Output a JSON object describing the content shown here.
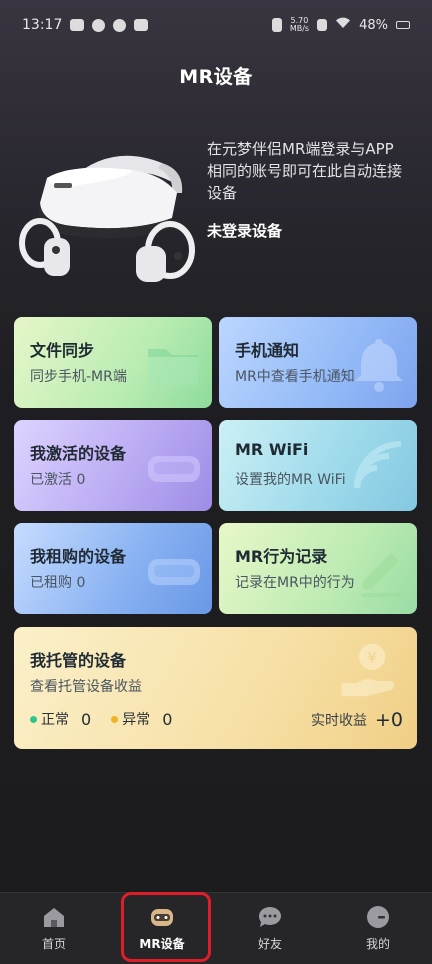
{
  "status_bar": {
    "time": "13:17",
    "net_speed_value": "5.70",
    "net_speed_unit": "MB/s",
    "battery": "48%"
  },
  "header": {
    "title": "MR设备"
  },
  "hero": {
    "description": "在元梦伴侣MR端登录与APP相同的账号即可在此自动连接设备",
    "status": "未登录设备"
  },
  "cards": {
    "file_sync": {
      "title": "文件同步",
      "subtitle": "同步手机-MR端"
    },
    "phone_notice": {
      "title": "手机通知",
      "subtitle": "MR中查看手机通知"
    },
    "activated": {
      "title": "我激活的设备",
      "subtitle": "已激活 0"
    },
    "wifi": {
      "title": "MR WiFi",
      "subtitle": "设置我的MR WiFi"
    },
    "rented": {
      "title": "我租购的设备",
      "subtitle": "已租购 0"
    },
    "behavior": {
      "title": "MR行为记录",
      "subtitle": "记录在MR中的行为"
    },
    "hosted": {
      "title": "我托管的设备",
      "subtitle": "查看托管设备收益",
      "normal_label": "正常",
      "normal_count": "0",
      "abnormal_label": "异常",
      "abnormal_count": "0",
      "earnings_label": "实时收益",
      "earnings_value": "+0"
    }
  },
  "tabbar": {
    "items": [
      {
        "label": "首页",
        "icon": "home-icon"
      },
      {
        "label": "MR设备",
        "icon": "mr-device-icon"
      },
      {
        "label": "好友",
        "icon": "friends-icon"
      },
      {
        "label": "我的",
        "icon": "profile-icon"
      }
    ],
    "active_index": 1
  },
  "colors": {
    "normal_dot": "#2cc68a",
    "abnormal_dot": "#f0b323",
    "highlight": "#e01e2a"
  }
}
